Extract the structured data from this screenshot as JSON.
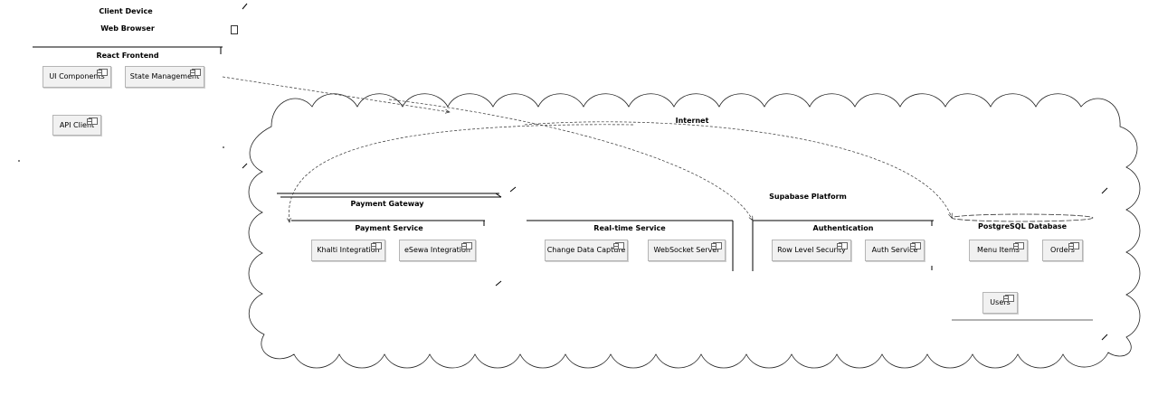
{
  "client_device": {
    "title": "Client Device",
    "browser_title": "Web Browser",
    "frontend_title": "React Frontend",
    "components": [
      "UI Components",
      "State Management",
      "API Client"
    ]
  },
  "internet": {
    "title": "Internet"
  },
  "payment_gateway": {
    "title": "Payment Gateway",
    "service_title": "Payment Service",
    "components": [
      "Khalti Integration",
      "eSewa Integration"
    ]
  },
  "supabase": {
    "title": "Supabase Platform",
    "realtime": {
      "title": "Real-time Service",
      "components": [
        "Change Data Capture",
        "WebSocket Server"
      ]
    },
    "auth": {
      "title": "Authentication",
      "components": [
        "Row Level Security",
        "Auth Service"
      ]
    },
    "database": {
      "title": "PostgreSQL Database",
      "components": [
        "Menu Items",
        "Orders",
        "Users"
      ]
    }
  }
}
